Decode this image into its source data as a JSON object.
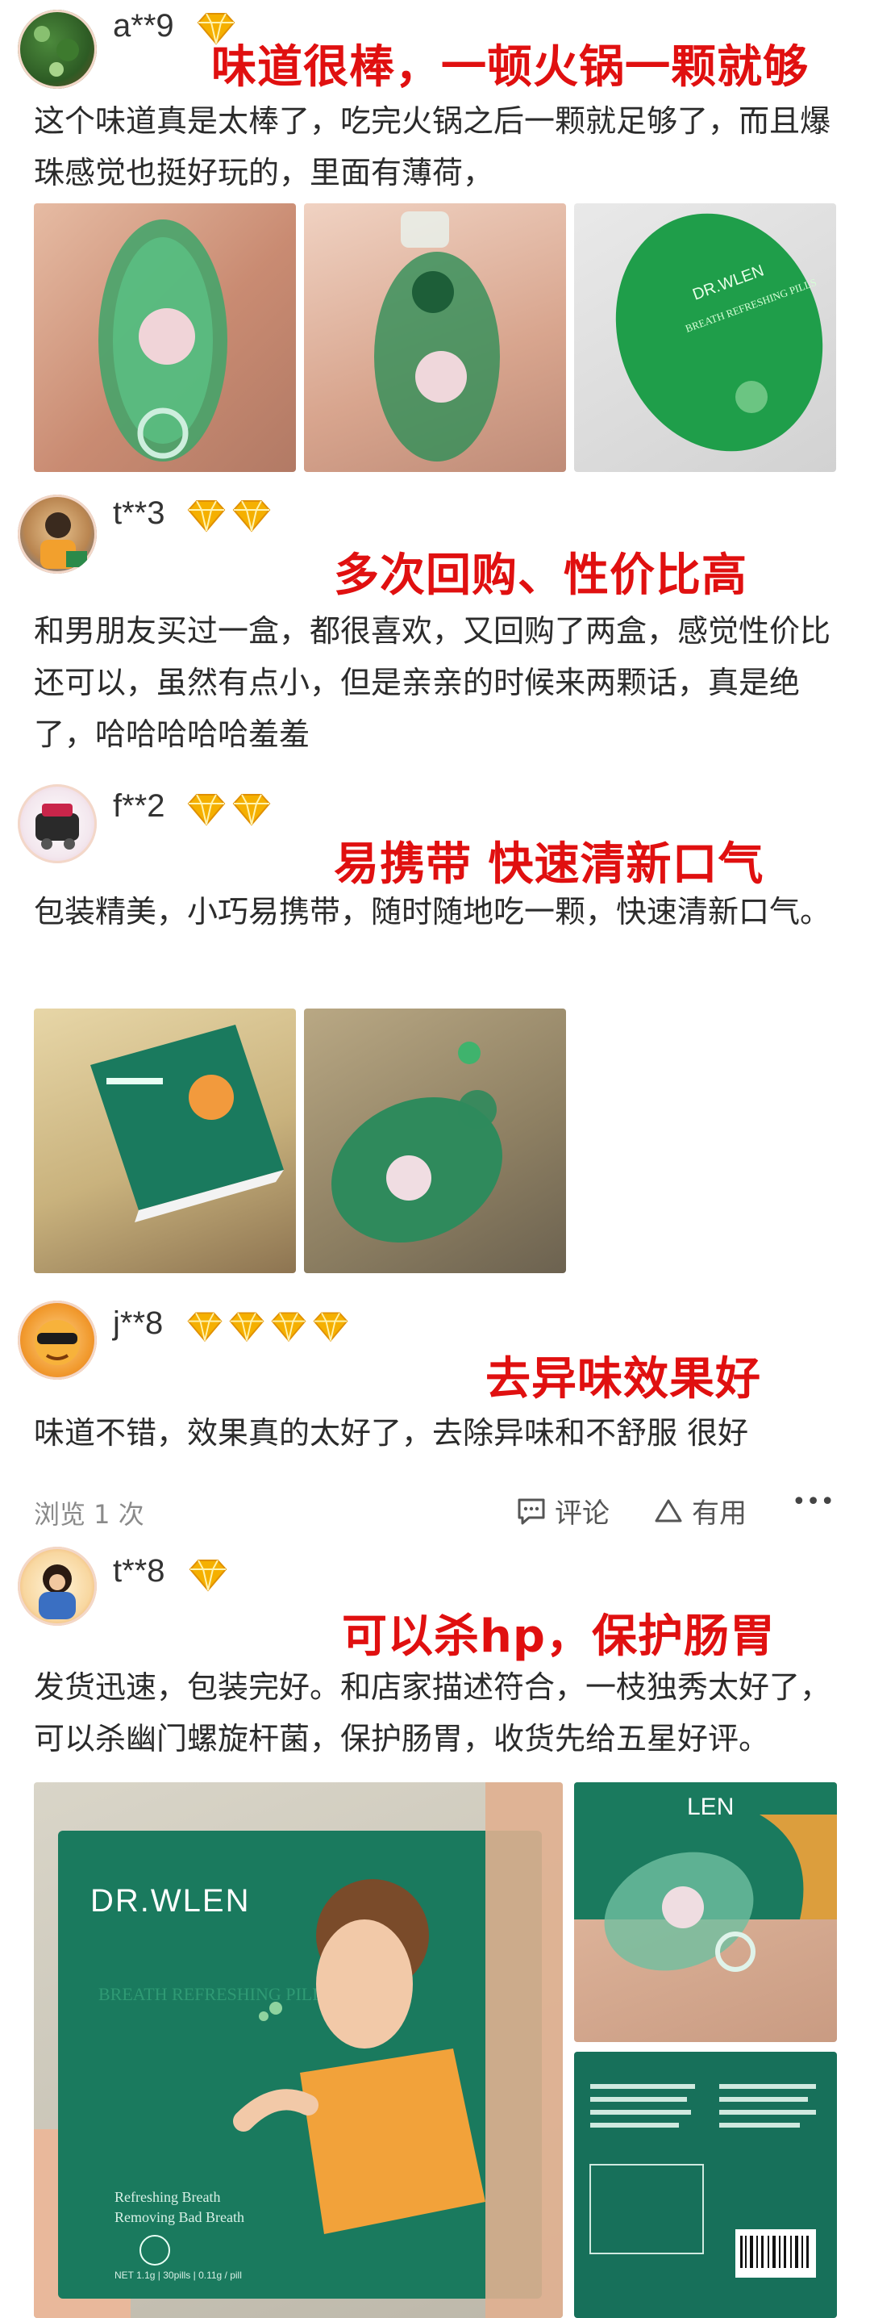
{
  "reviews": [
    {
      "username": "a**9",
      "diamonds": 1,
      "headline": "味道很棒，一顿火锅一颗就够",
      "text": "这个味道真是太棒了，吃完火锅之后一颗就足够了，而且爆珠感觉也挺好玩的，里面有薄荷，",
      "photo_texts": [
        "DR.WLEN",
        "BREATH REFRESHING PILLS"
      ]
    },
    {
      "username": "t**3",
      "diamonds": 2,
      "headline": "多次回购、性价比高",
      "text": "和男朋友买过一盒，都很喜欢，又回购了两盒，感觉性价比还可以，虽然有点小，但是亲亲的时候来两颗话，真是绝了，哈哈哈哈哈羞羞"
    },
    {
      "username": "f**2",
      "diamonds": 2,
      "headline": "易携带 快速清新口气",
      "text": "包装精美，小巧易携带，随时随地吃一颗，快速清新口气。"
    },
    {
      "username": "j**8",
      "diamonds": 4,
      "headline": "去异味效果好",
      "text": "味道不错，效果真的太好了，去除异味和不舒服 很好",
      "views": "浏览 1 次",
      "comment_label": "评论",
      "useful_label": "有用",
      "more_label": "•••"
    },
    {
      "username": "t**8",
      "diamonds": 1,
      "headline": "可以杀hp，保护肠胃",
      "text": "发货迅速，包装完好。和店家描述符合，一枝独秀太好了，可以杀幽门螺旋杆菌，保护肠胃，收货先给五星好评。",
      "box_brand": "DR.WLEN",
      "box_title": "BREATH REFRESHING PILLS",
      "box_sub1": "Refreshing Breath",
      "box_sub2": "Removing Bad Breath",
      "box_net": "NET 1.1g | 30pills | 0.11g / pill",
      "box_top": "LEN"
    }
  ],
  "colors": {
    "headline": "#e01010",
    "diamond": "#f5b000",
    "pill_green": "#1f9e4a",
    "box_green": "#1a7a5e"
  }
}
